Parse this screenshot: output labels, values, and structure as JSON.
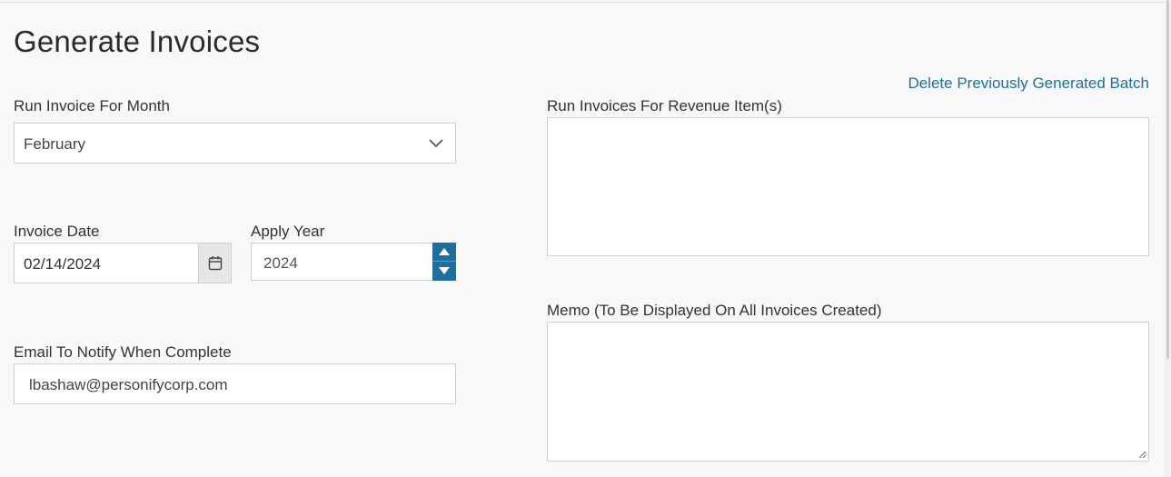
{
  "page": {
    "title": "Generate Invoices",
    "delete_link": "Delete Previously Generated Batch"
  },
  "form": {
    "month": {
      "label": "Run Invoice For Month",
      "value": "February"
    },
    "invoice_date": {
      "label": "Invoice Date",
      "value": "02/14/2024"
    },
    "apply_year": {
      "label": "Apply Year",
      "value": "2024"
    },
    "email": {
      "label": "Email To Notify When Complete",
      "value": "lbashaw@personifycorp.com"
    },
    "revenue_items": {
      "label": "Run Invoices For Revenue Item(s)",
      "value": ""
    },
    "memo": {
      "label": "Memo (To Be Displayed On All Invoices Created)",
      "value": ""
    }
  },
  "icons": {
    "month_dropdown": "chevron-down-icon",
    "date_picker": "calendar-icon",
    "year_up": "arrow-up-icon",
    "year_down": "arrow-down-icon",
    "memo_resize": "resize-handle-icon"
  },
  "colors": {
    "accent": "#1f6f9e",
    "background": "#f8f8f8",
    "border": "#cfcfcf"
  }
}
